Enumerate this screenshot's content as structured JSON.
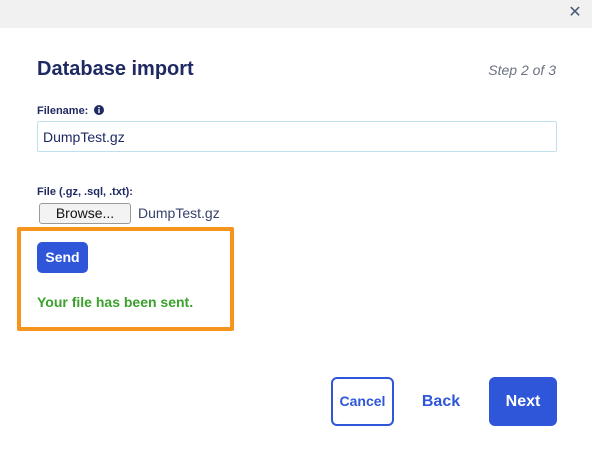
{
  "dialog": {
    "title": "Database import",
    "step": "Step 2 of 3",
    "close_icon": "close-icon"
  },
  "form": {
    "filename_label": "Filename:",
    "filename_info_icon": "info-icon",
    "filename_value": "DumpTest.gz",
    "file_label": "File (.gz, .sql, .txt):",
    "browse_label": "Browse...",
    "chosen_file": "DumpTest.gz",
    "send_label": "Send",
    "success_message": "Your file has been sent."
  },
  "footer": {
    "cancel_label": "Cancel",
    "back_label": "Back",
    "next_label": "Next"
  },
  "colors": {
    "accent": "#2f56d9",
    "title": "#1f2a63",
    "success": "#3aa12b",
    "highlight": "#f7941d"
  }
}
